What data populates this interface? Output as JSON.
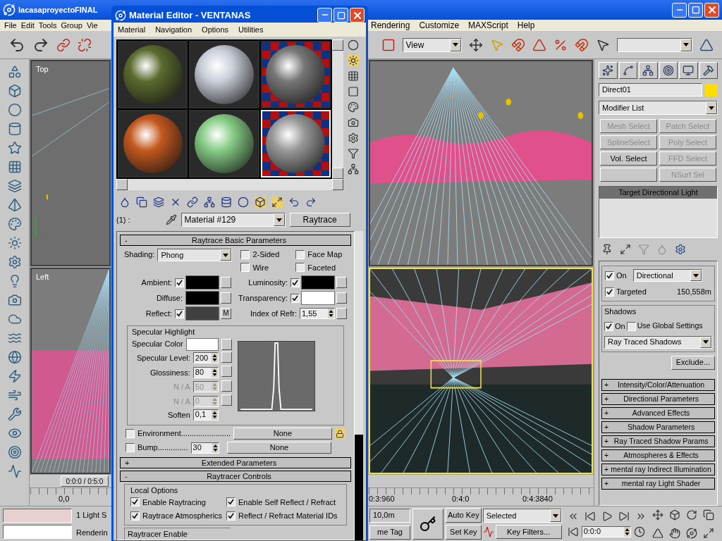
{
  "main_window": {
    "title": "lacasaproyectoFINAL",
    "menu_left": [
      "File",
      "Edit",
      "Tools",
      "Group",
      "Vie"
    ],
    "menu_right": [
      "Rendering",
      "Customize",
      "MAXScript",
      "Help"
    ],
    "reference_coord": "View",
    "viewports": [
      {
        "label": "Top",
        "active": false
      },
      {
        "active": false
      },
      {
        "label": "Left",
        "active": false
      },
      {
        "active": true
      }
    ],
    "time_slider": "0:0:0 / 0:5:0",
    "ruler_labels": [
      "0,0",
      "0:3:960",
      "0:4:0",
      "0:4:3840"
    ],
    "status": {
      "prompt_lines": [
        "1 Light S",
        "Renderin"
      ],
      "grid": "10,0m",
      "time_tag": "me Tag",
      "auto_key": "Auto Key",
      "set_key": "Set Key",
      "key_mode": "Selected",
      "key_filters": "Key Filters...",
      "current_time": "0:0:0"
    }
  },
  "command_panel": {
    "object": {
      "name": "Direct01",
      "color": "#ffdd00"
    },
    "modifier_list": "Modifier List",
    "modifier_buttons": [
      {
        "kind": "button",
        "label": "Mesh Select",
        "disabled": true
      },
      {
        "kind": "button",
        "label": "Patch Select",
        "disabled": true
      },
      {
        "kind": "button",
        "label": "SplineSelect",
        "disabled": true
      },
      {
        "kind": "button",
        "label": "Poly Select",
        "disabled": true
      },
      {
        "kind": "button",
        "label": "Vol. Select",
        "disabled": false
      },
      {
        "kind": "button",
        "label": "FFD Select",
        "disabled": true
      },
      {
        "kind": "blank"
      },
      {
        "kind": "button",
        "label": "NSurf Sel",
        "disabled": true
      }
    ],
    "stack": [
      {
        "label": "Target Directional Light",
        "selected": true
      }
    ],
    "light_type": {
      "on": {
        "label": "On",
        "checked": true
      },
      "type": "Directional",
      "targeted": {
        "label": "Targeted",
        "checked": true
      },
      "distance": "150,558m"
    },
    "shadows": {
      "title": "Shadows",
      "on": {
        "label": "On",
        "checked": true
      },
      "use_global": {
        "label": "Use Global Settings",
        "checked": false
      },
      "type": "Ray Traced Shadows",
      "exclude": "Exclude..."
    },
    "rollouts": [
      {
        "sign": "+",
        "label": "Intensity/Color/Attenuation"
      },
      {
        "sign": "+",
        "label": "Directional Parameters"
      },
      {
        "sign": "+",
        "label": "Advanced Effects"
      },
      {
        "sign": "+",
        "label": "Shadow Parameters"
      },
      {
        "sign": "+",
        "label": "Ray Traced Shadow Params"
      },
      {
        "sign": "+",
        "label": "Atmospheres & Effects"
      },
      {
        "sign": "+",
        "label": "mental ray Indirect Illumination"
      },
      {
        "sign": "+",
        "label": "mental ray Light Shader"
      }
    ]
  },
  "material_editor": {
    "title": "Material Editor - VENTANAS",
    "menu": [
      "Material",
      "Navigation",
      "Options",
      "Utilities"
    ],
    "sample_slots": [
      {
        "kind": "sphere",
        "color": "#5b6b2e",
        "selected": false
      },
      {
        "kind": "sphere",
        "color": "#c9ced8",
        "selected": false
      },
      {
        "kind": "checker",
        "color": "#777777",
        "selected": false
      },
      {
        "kind": "sphere",
        "color": "#c4581e",
        "selected": false
      },
      {
        "kind": "sphere",
        "color": "#86cc86",
        "selected": false
      },
      {
        "kind": "checker",
        "color": "#999999",
        "selected": true
      }
    ],
    "slot_label": "(1) :",
    "material_name": "Material #129",
    "material_type": "Raytrace",
    "basic": {
      "sign": "-",
      "title": "Raytrace Basic Parameters",
      "shading_label": "Shading:",
      "shading": "Phong",
      "options": [
        {
          "label": "2-Sided",
          "checked": false
        },
        {
          "label": "Face Map",
          "checked": false
        },
        {
          "label": "Wire",
          "checked": false
        },
        {
          "label": "Faceted",
          "checked": false
        }
      ],
      "color_rows": [
        {
          "kind": "color",
          "label": "Ambient:",
          "checked": true,
          "color": "#000000"
        },
        {
          "kind": "color",
          "label": "Luminosity:",
          "checked": true,
          "color": "#000000"
        },
        {
          "kind": "color",
          "label": "Diffuse:",
          "color": "#000000"
        },
        {
          "kind": "color",
          "label": "Transparency:",
          "checked": true,
          "color": "#ffffff"
        },
        {
          "kind": "color",
          "label": "Reflect:",
          "checked": true,
          "color": "#404040",
          "map": "M"
        },
        {
          "kind": "spinner",
          "label": "Index of Refr:",
          "value": "1,55"
        }
      ],
      "specular": {
        "title": "Specular Highlight",
        "color_label": "Specular Color",
        "color": "#ffffff",
        "params": [
          {
            "label": "Specular Level:",
            "value": "200",
            "disabled": false,
            "map_slot": true
          },
          {
            "label": "Glossiness:",
            "value": "80",
            "disabled": false,
            "map_slot": true
          },
          {
            "label": "N / A",
            "value": "50",
            "disabled": true,
            "map_slot": true
          },
          {
            "label": "N / A",
            "value": "0",
            "disabled": true,
            "map_slot": true
          },
          {
            "label": "Soften",
            "value": "0,1",
            "disabled": false,
            "map_slot": false
          }
        ]
      },
      "maps": [
        {
          "label": "Environment.......................",
          "checked": false,
          "map": "None",
          "lock": true
        },
        {
          "label": "Bump..............",
          "checked": false,
          "amount": "30",
          "map": "None",
          "lock": false
        }
      ]
    },
    "extended": {
      "sign": "+",
      "title": "Extended Parameters"
    },
    "raytracer": {
      "sign": "-",
      "title": "Raytracer Controls",
      "group": "Local Options",
      "options": [
        {
          "label": "Enable Raytracing",
          "checked": true
        },
        {
          "label": "Enable Self Reflect / Refract",
          "checked": true
        },
        {
          "label": "Raytrace Atmospherics",
          "checked": true
        },
        {
          "label": "Reflect / Refract Material IDs",
          "checked": true
        }
      ],
      "enable_group": "Raytracer Enable"
    }
  }
}
